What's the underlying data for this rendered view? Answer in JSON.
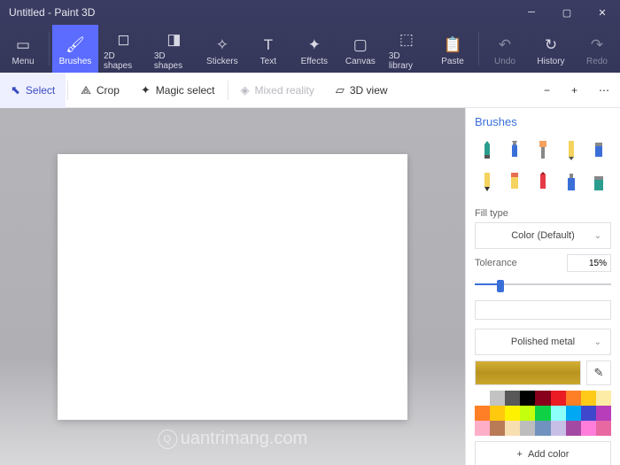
{
  "title": "Untitled - Paint 3D",
  "ribbon": {
    "menu": "Menu",
    "items": [
      {
        "label": "Brushes",
        "icon": "🖌"
      },
      {
        "label": "2D shapes",
        "icon": "◻"
      },
      {
        "label": "3D shapes",
        "icon": "◨"
      },
      {
        "label": "Stickers",
        "icon": "✧"
      },
      {
        "label": "Text",
        "icon": "T"
      },
      {
        "label": "Effects",
        "icon": "✦"
      },
      {
        "label": "Canvas",
        "icon": "▢"
      },
      {
        "label": "3D library",
        "icon": "⬚"
      }
    ],
    "paste": "Paste",
    "undo": "Undo",
    "history": "History",
    "redo": "Redo"
  },
  "toolbar": {
    "select": "Select",
    "crop": "Crop",
    "magic": "Magic select",
    "mixed": "Mixed reality",
    "view3d": "3D view"
  },
  "side": {
    "title": "Brushes",
    "filltype_label": "Fill type",
    "filltype_value": "Color (Default)",
    "tolerance_label": "Tolerance",
    "tolerance_value": "15%",
    "material": "Polished metal",
    "addcolor": "Add color",
    "palette": [
      "#ffffff",
      "#c3c3c3",
      "#585858",
      "#000000",
      "#88001b",
      "#ec1c24",
      "#ff7f27",
      "#ffca18",
      "#fdeca6",
      "#ff7f27",
      "#ffc90e",
      "#fff200",
      "#c4ff0e",
      "#0ed145",
      "#8cfffb",
      "#00a8f3",
      "#3f48cc",
      "#b83dba",
      "#ffaec8",
      "#b97a56",
      "#f8dfb1",
      "#bdbdbd",
      "#7092be",
      "#c8bfe7",
      "#a349a4",
      "#ff7edb",
      "#e868a2"
    ]
  },
  "watermark": "uantrimang.com"
}
